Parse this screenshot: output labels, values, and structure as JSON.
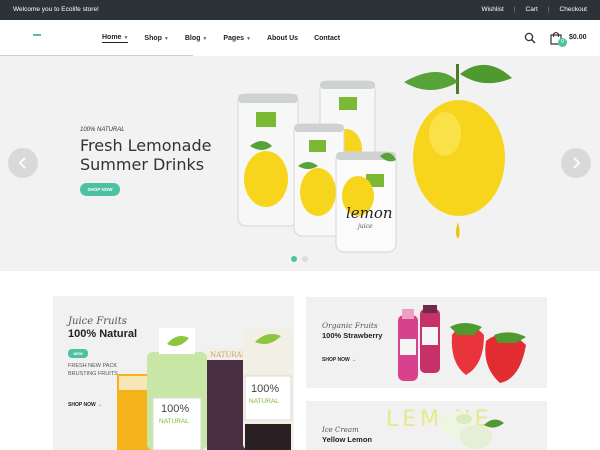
{
  "topbar": {
    "welcome": "Welcome you to Ecolife store!",
    "links": [
      "Wishlist",
      "Cart",
      "Checkout"
    ]
  },
  "nav": {
    "items": [
      {
        "label": "Home",
        "has_dropdown": true,
        "active": true
      },
      {
        "label": "Shop",
        "has_dropdown": true
      },
      {
        "label": "Blog",
        "has_dropdown": true
      },
      {
        "label": "Pages",
        "has_dropdown": true
      },
      {
        "label": "About Us",
        "has_dropdown": false
      },
      {
        "label": "Contact",
        "has_dropdown": false
      }
    ],
    "cart_count": "0",
    "cart_total": "$0.00"
  },
  "hero": {
    "eyebrow": "100% NATURAL",
    "title_line1": "Fresh Lemonade",
    "title_line2": "Summer Drinks",
    "button": "SHOP NOW",
    "can_brand": "lemon",
    "can_sub": "juice"
  },
  "banners": {
    "juice": {
      "script": "Juice Fruits",
      "title": "100% Natural",
      "badge": "NEW",
      "desc": "FRESH NEW PACK BRUSTING FRUITS",
      "cta": "SHOP NOW",
      "bottle_label_top": "100%",
      "bottle_label_bottom": "NATURAL",
      "bottle_script": "NATURAL J"
    },
    "strawberry": {
      "script": "Organic Fruits",
      "title": "100% Strawberry",
      "cta": "SHOP NOW"
    },
    "icecream": {
      "script": "Ice Cream",
      "title": "Yellow Lemon",
      "watermark": "LEM  NE"
    }
  },
  "colors": {
    "accent": "#4fc1a3",
    "topbar": "#2b3238",
    "lemon": "#f7d51d"
  }
}
